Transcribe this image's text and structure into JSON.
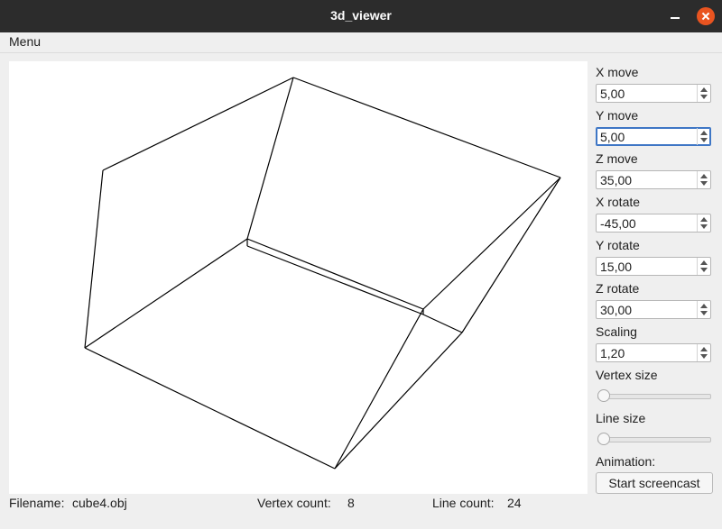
{
  "window": {
    "title": "3d_viewer"
  },
  "menu": {
    "label": "Menu"
  },
  "controls": [
    {
      "label": "X move",
      "value": "5,00"
    },
    {
      "label": "Y move",
      "value": "5,00",
      "focused": true
    },
    {
      "label": "Z move",
      "value": "35,00"
    },
    {
      "label": "X rotate",
      "value": "-45,00"
    },
    {
      "label": "Y rotate",
      "value": "15,00"
    },
    {
      "label": "Z rotate",
      "value": "30,00"
    },
    {
      "label": "Scaling",
      "value": "1,20"
    }
  ],
  "sliders": [
    {
      "label": "Vertex size",
      "level": 0
    },
    {
      "label": "Line size",
      "level": 0
    }
  ],
  "animation": {
    "label": "Animation:",
    "button": "Start screencast"
  },
  "status": {
    "filename_label": "Filename:",
    "filename": "cube4.obj",
    "vertex_label": "Vertex count:",
    "vertex_count": "8",
    "line_label": "Line count:",
    "line_count": "24"
  },
  "colors": {
    "titlebar": "#2c2c2c",
    "close": "#e95420",
    "focus": "#3e76c5",
    "edges": "#000000"
  }
}
